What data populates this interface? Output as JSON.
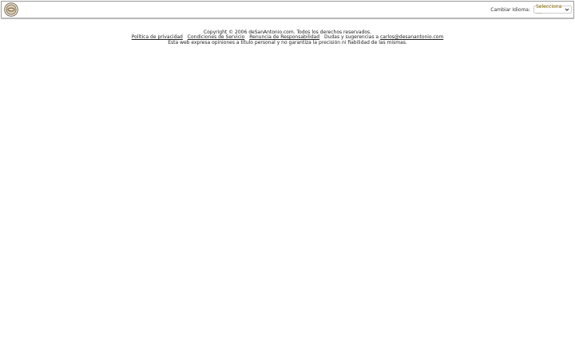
{
  "header": {
    "language_label": "Cambiar Idioma:",
    "language_select_value": "Selecciona ...."
  },
  "footer": {
    "copyright": "Copyright © 2006 deSanAntonio.com. Todos los derechos reservados.",
    "links": [
      "Política de privacidad",
      "Condiciones de Servicio",
      "Renuncia de Responsabilidad"
    ],
    "contact_text": "Dudas y sugerencias a",
    "contact_email": "carlos@desanantonio.com",
    "disclaimer": "Esta web expresa opiniones a título personal y no garantiza la precisión ni fiabilidad de las mismas."
  },
  "icons": {
    "logo": "site-logo-icon",
    "select_arrow": "chevron-down-icon"
  },
  "colors": {
    "select_text": "#8a6a00",
    "border": "#9a9a9a",
    "text": "#222222"
  }
}
